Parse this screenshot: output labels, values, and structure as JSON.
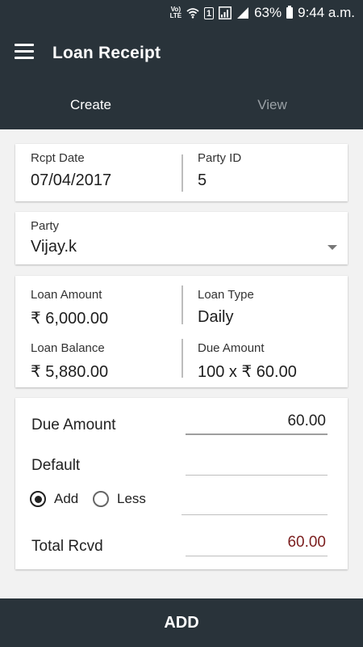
{
  "status_bar": {
    "volte_top": "Vo)",
    "volte_bottom": "LTE",
    "sim": "1",
    "battery": "63%",
    "time": "9:44 a.m."
  },
  "app_bar": {
    "title": "Loan Receipt",
    "menu_icon": "menu-icon"
  },
  "tabs": [
    {
      "label": "Create",
      "active": true
    },
    {
      "label": "View",
      "active": false
    }
  ],
  "receipt": {
    "rcpt_date_label": "Rcpt Date",
    "rcpt_date": "07/04/2017",
    "party_id_label": "Party ID",
    "party_id": "5"
  },
  "party": {
    "label": "Party",
    "value": "Vijay.k"
  },
  "loan": {
    "amount_label": "Loan Amount",
    "amount": "₹ 6,000.00",
    "type_label": "Loan Type",
    "type": "Daily",
    "balance_label": "Loan Balance",
    "balance": "₹ 5,880.00",
    "due_label": "Due Amount",
    "due": "100 x ₹ 60.00"
  },
  "form": {
    "due_amount_label": "Due Amount",
    "due_amount_value": "60.00",
    "default_label": "Default",
    "default_value": "",
    "adjust_value": "",
    "radio_add": "Add",
    "radio_less": "Less",
    "radio_selected": "Add",
    "total_label": "Total Rcvd",
    "total_value": "60.00",
    "total_color": "#7b1e1e"
  },
  "action": {
    "add_label": "ADD"
  },
  "colors": {
    "header_bg": "#29333a",
    "page_bg": "#f2f2f2"
  }
}
